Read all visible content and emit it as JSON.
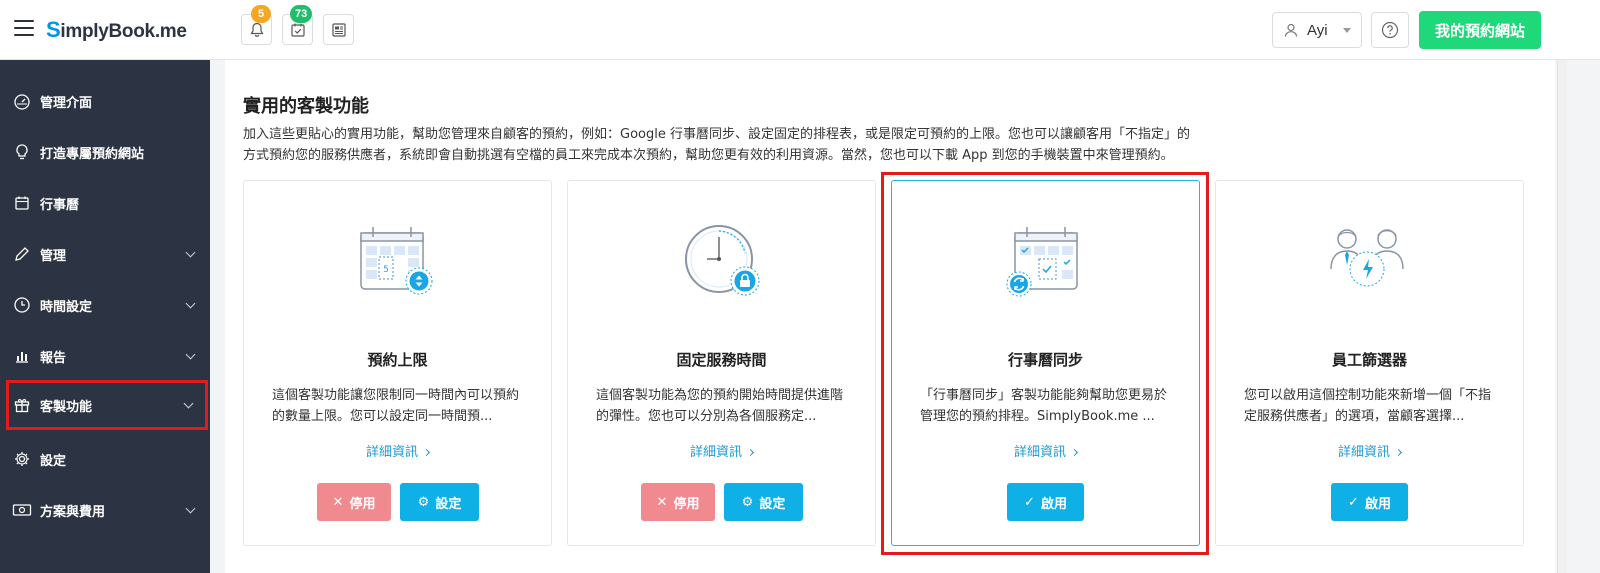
{
  "app": {
    "logo_s": "S",
    "logo_rest": "implyBook",
    "logo_me": ".me"
  },
  "header": {
    "notifications_badge": "5",
    "bookings_badge": "73",
    "user_name": "Ayi",
    "site_button": "我的預約網站"
  },
  "sidebar": {
    "items": [
      {
        "label": "管理介面",
        "icon": "dashboard-icon"
      },
      {
        "label": "打造專屬預約網站",
        "icon": "lightbulb-icon"
      },
      {
        "label": "行事曆",
        "icon": "calendar-icon"
      },
      {
        "label": "管理",
        "icon": "pencil-icon"
      },
      {
        "label": "時間設定",
        "icon": "clock-icon"
      },
      {
        "label": "報告",
        "icon": "bar-chart-icon"
      },
      {
        "label": "客製功能",
        "icon": "gift-icon"
      },
      {
        "label": "設定",
        "icon": "gear-icon"
      },
      {
        "label": "方案與費用",
        "icon": "money-icon"
      }
    ]
  },
  "section": {
    "title": "實用的客製功能",
    "desc_line1": "加入這些更貼心的實用功能，幫助您管理來自顧客的預約，例如：Google 行事曆同步、設定固定的排程表，或是限定可預約的上限。您也可以讓顧客用「不指定」的",
    "desc_line2": "方式預約您的服務供應者，系統即會自動挑選有空檔的員工來完成本次預約，幫助您更有效的利用資源。當然，您也可以下載 App 到您的手機裝置中來管理預約。"
  },
  "cards": [
    {
      "title": "預約上限",
      "desc": "這個客製功能讓您限制同一時間內可以預約的數量上限。您可以設定同一時間預...",
      "more": "詳細資訊",
      "disable_label": "停用",
      "settings_label": "設定",
      "calendar_number": "5"
    },
    {
      "title": "固定服務時間",
      "desc": "這個客製功能為您的預約開始時間提供進階的彈性。您也可以分別為各個服務定...",
      "more": "詳細資訊",
      "disable_label": "停用",
      "settings_label": "設定"
    },
    {
      "title": "行事曆同步",
      "desc": "「行事曆同步」客製功能能夠幫助您更易於管理您的預約排程。SimplyBook.me ...",
      "more": "詳細資訊",
      "enable_label": "啟用"
    },
    {
      "title": "員工篩選器",
      "desc": "您可以啟用這個控制功能來新增一個「不指定服務供應者」的選項，當顧客選擇...",
      "more": "詳細資訊",
      "enable_label": "啟用"
    }
  ],
  "colors": {
    "sidebar_bg": "#2c3443",
    "accent_blue": "#0eb0e6",
    "green": "#1fd87a",
    "disable_red": "#f08a8e",
    "highlight_red": "#e31b1b"
  }
}
